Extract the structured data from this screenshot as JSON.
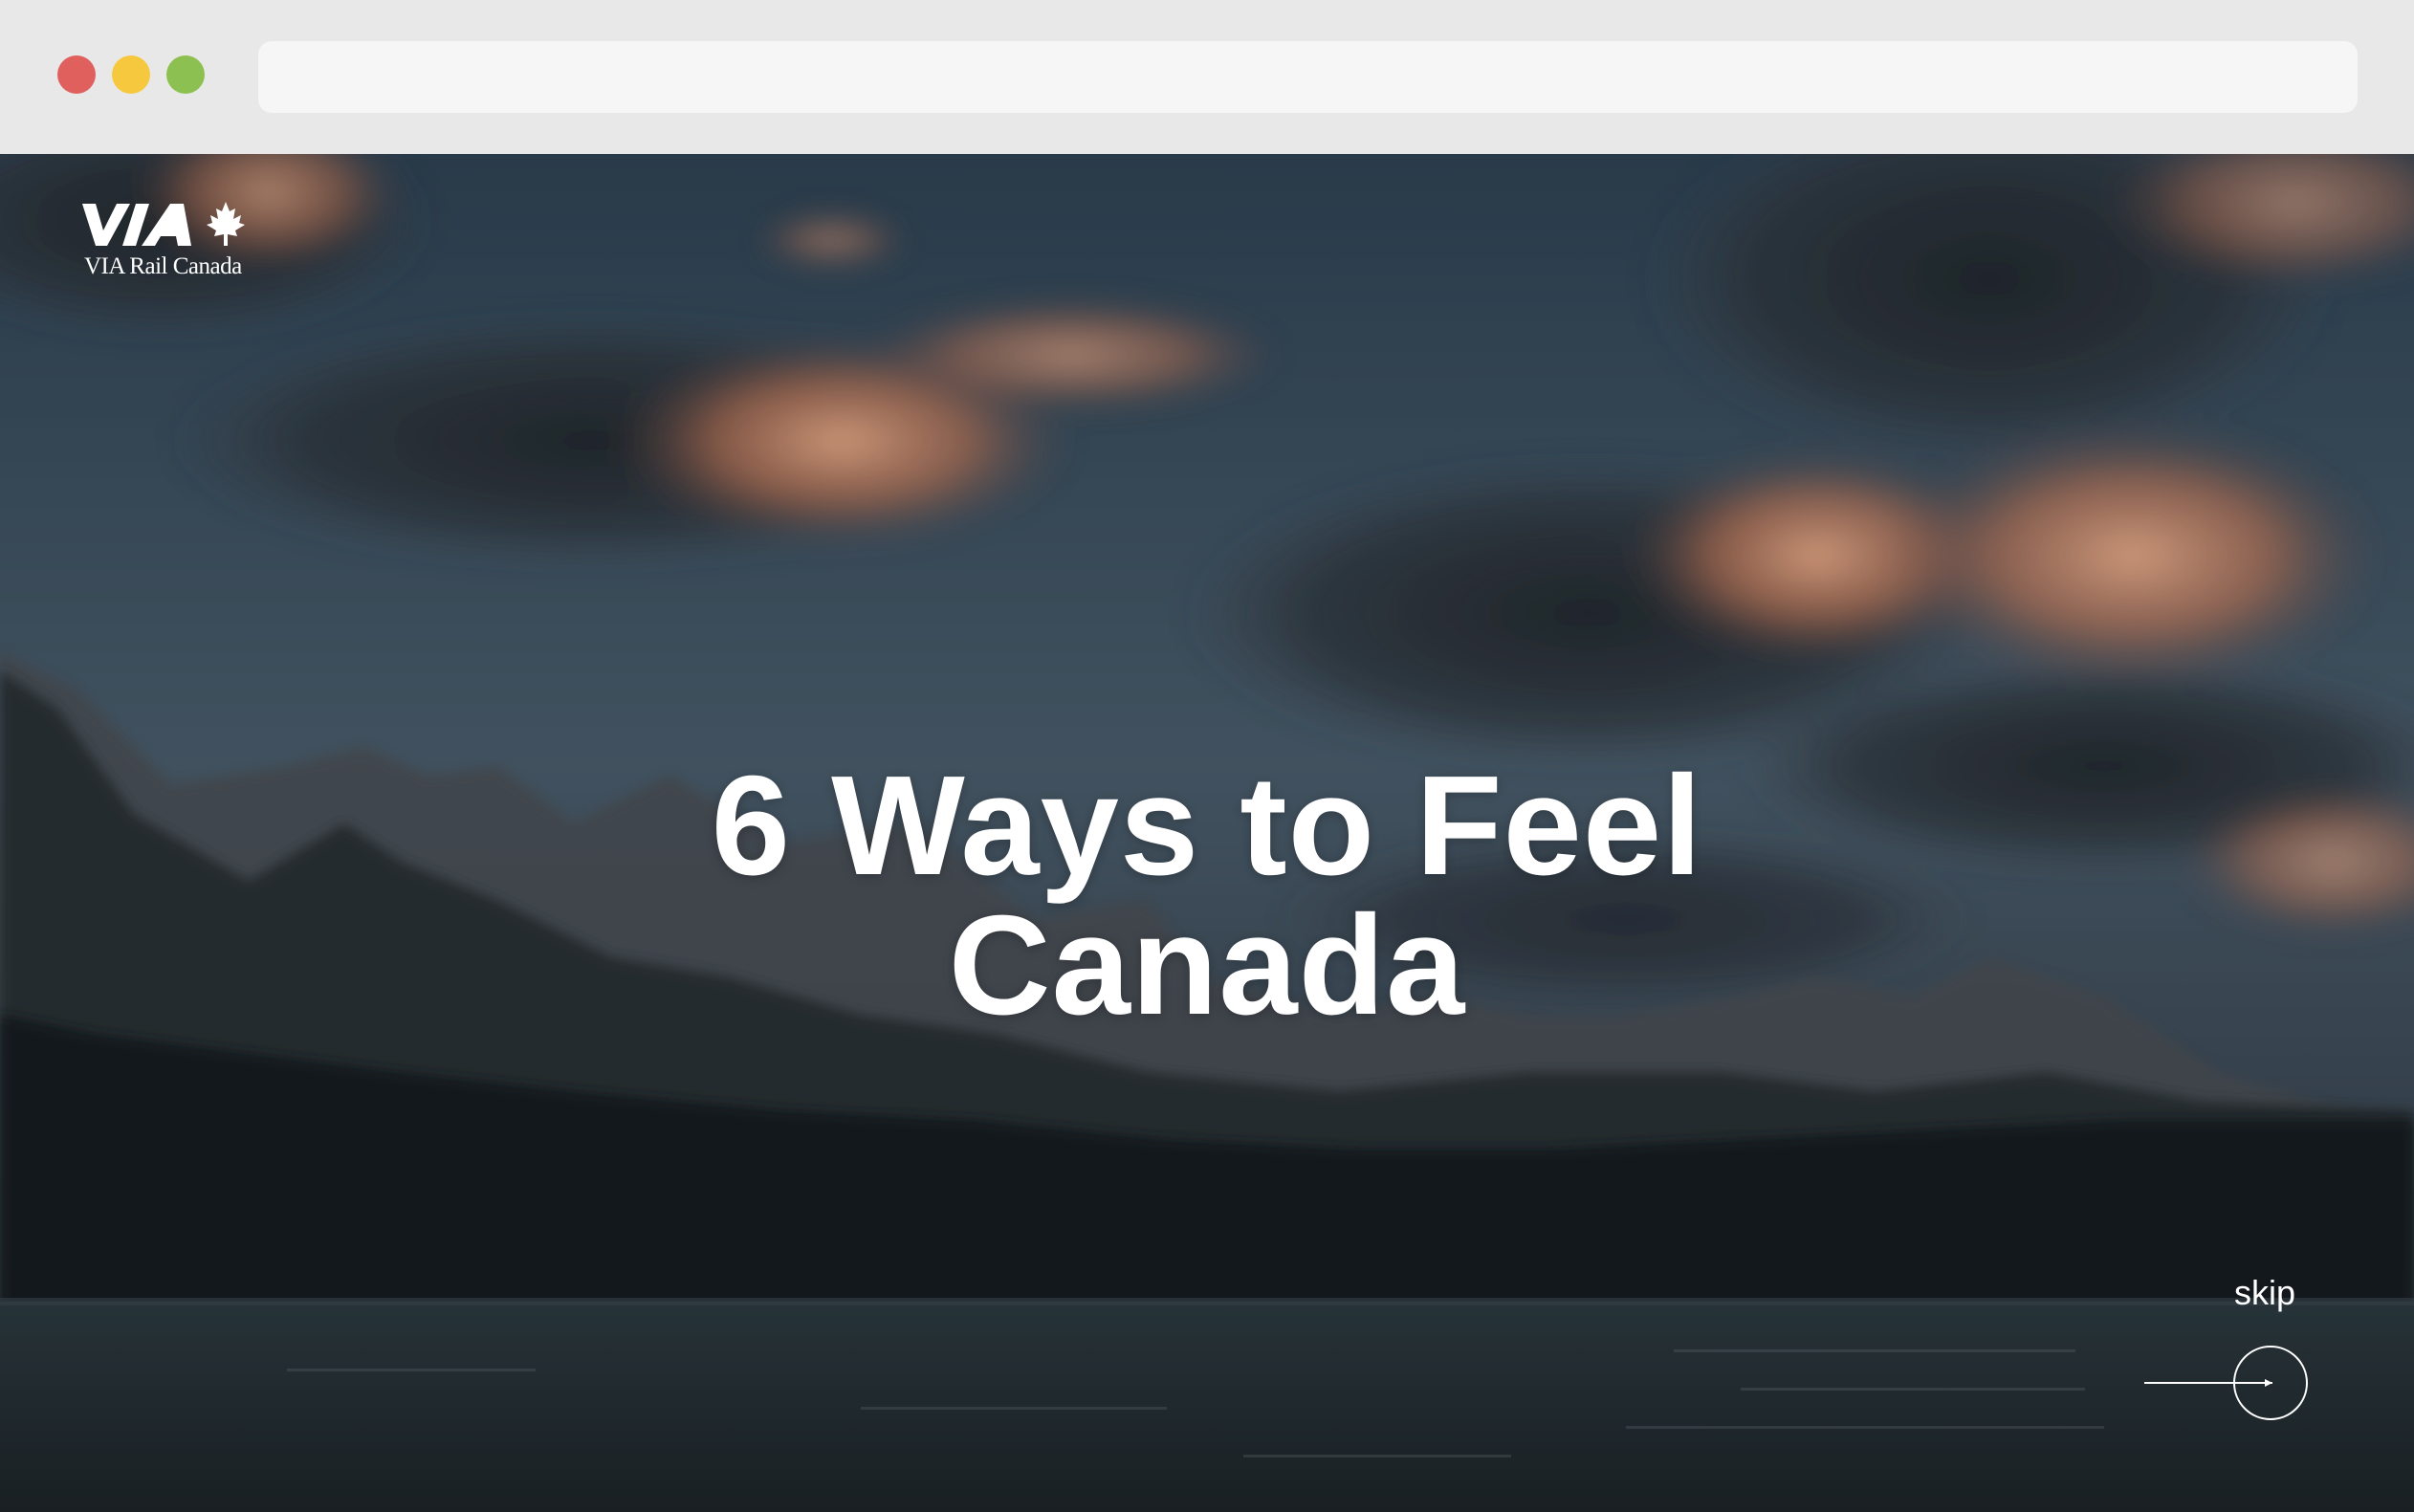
{
  "browser": {
    "traffic_lights": [
      "close",
      "minimize",
      "maximize"
    ],
    "address_value": ""
  },
  "brand": {
    "logo_wordmark": "VIA",
    "logo_subtitle": "VIA Rail Canada",
    "logo_icon": "maple-leaf-icon"
  },
  "hero": {
    "headline_line1": "6 Ways to Feel",
    "headline_line2": "Canada",
    "background": "sunset-mountain-lake-video"
  },
  "controls": {
    "skip_label": "skip",
    "skip_icon": "arrow-right-circle-icon"
  },
  "colors": {
    "chrome_bg": "#e8e8e8",
    "address_bg": "#f6f6f6",
    "close": "#e0605e",
    "minimize": "#f6c83e",
    "maximize": "#8cc152",
    "headline": "#ffffff"
  }
}
